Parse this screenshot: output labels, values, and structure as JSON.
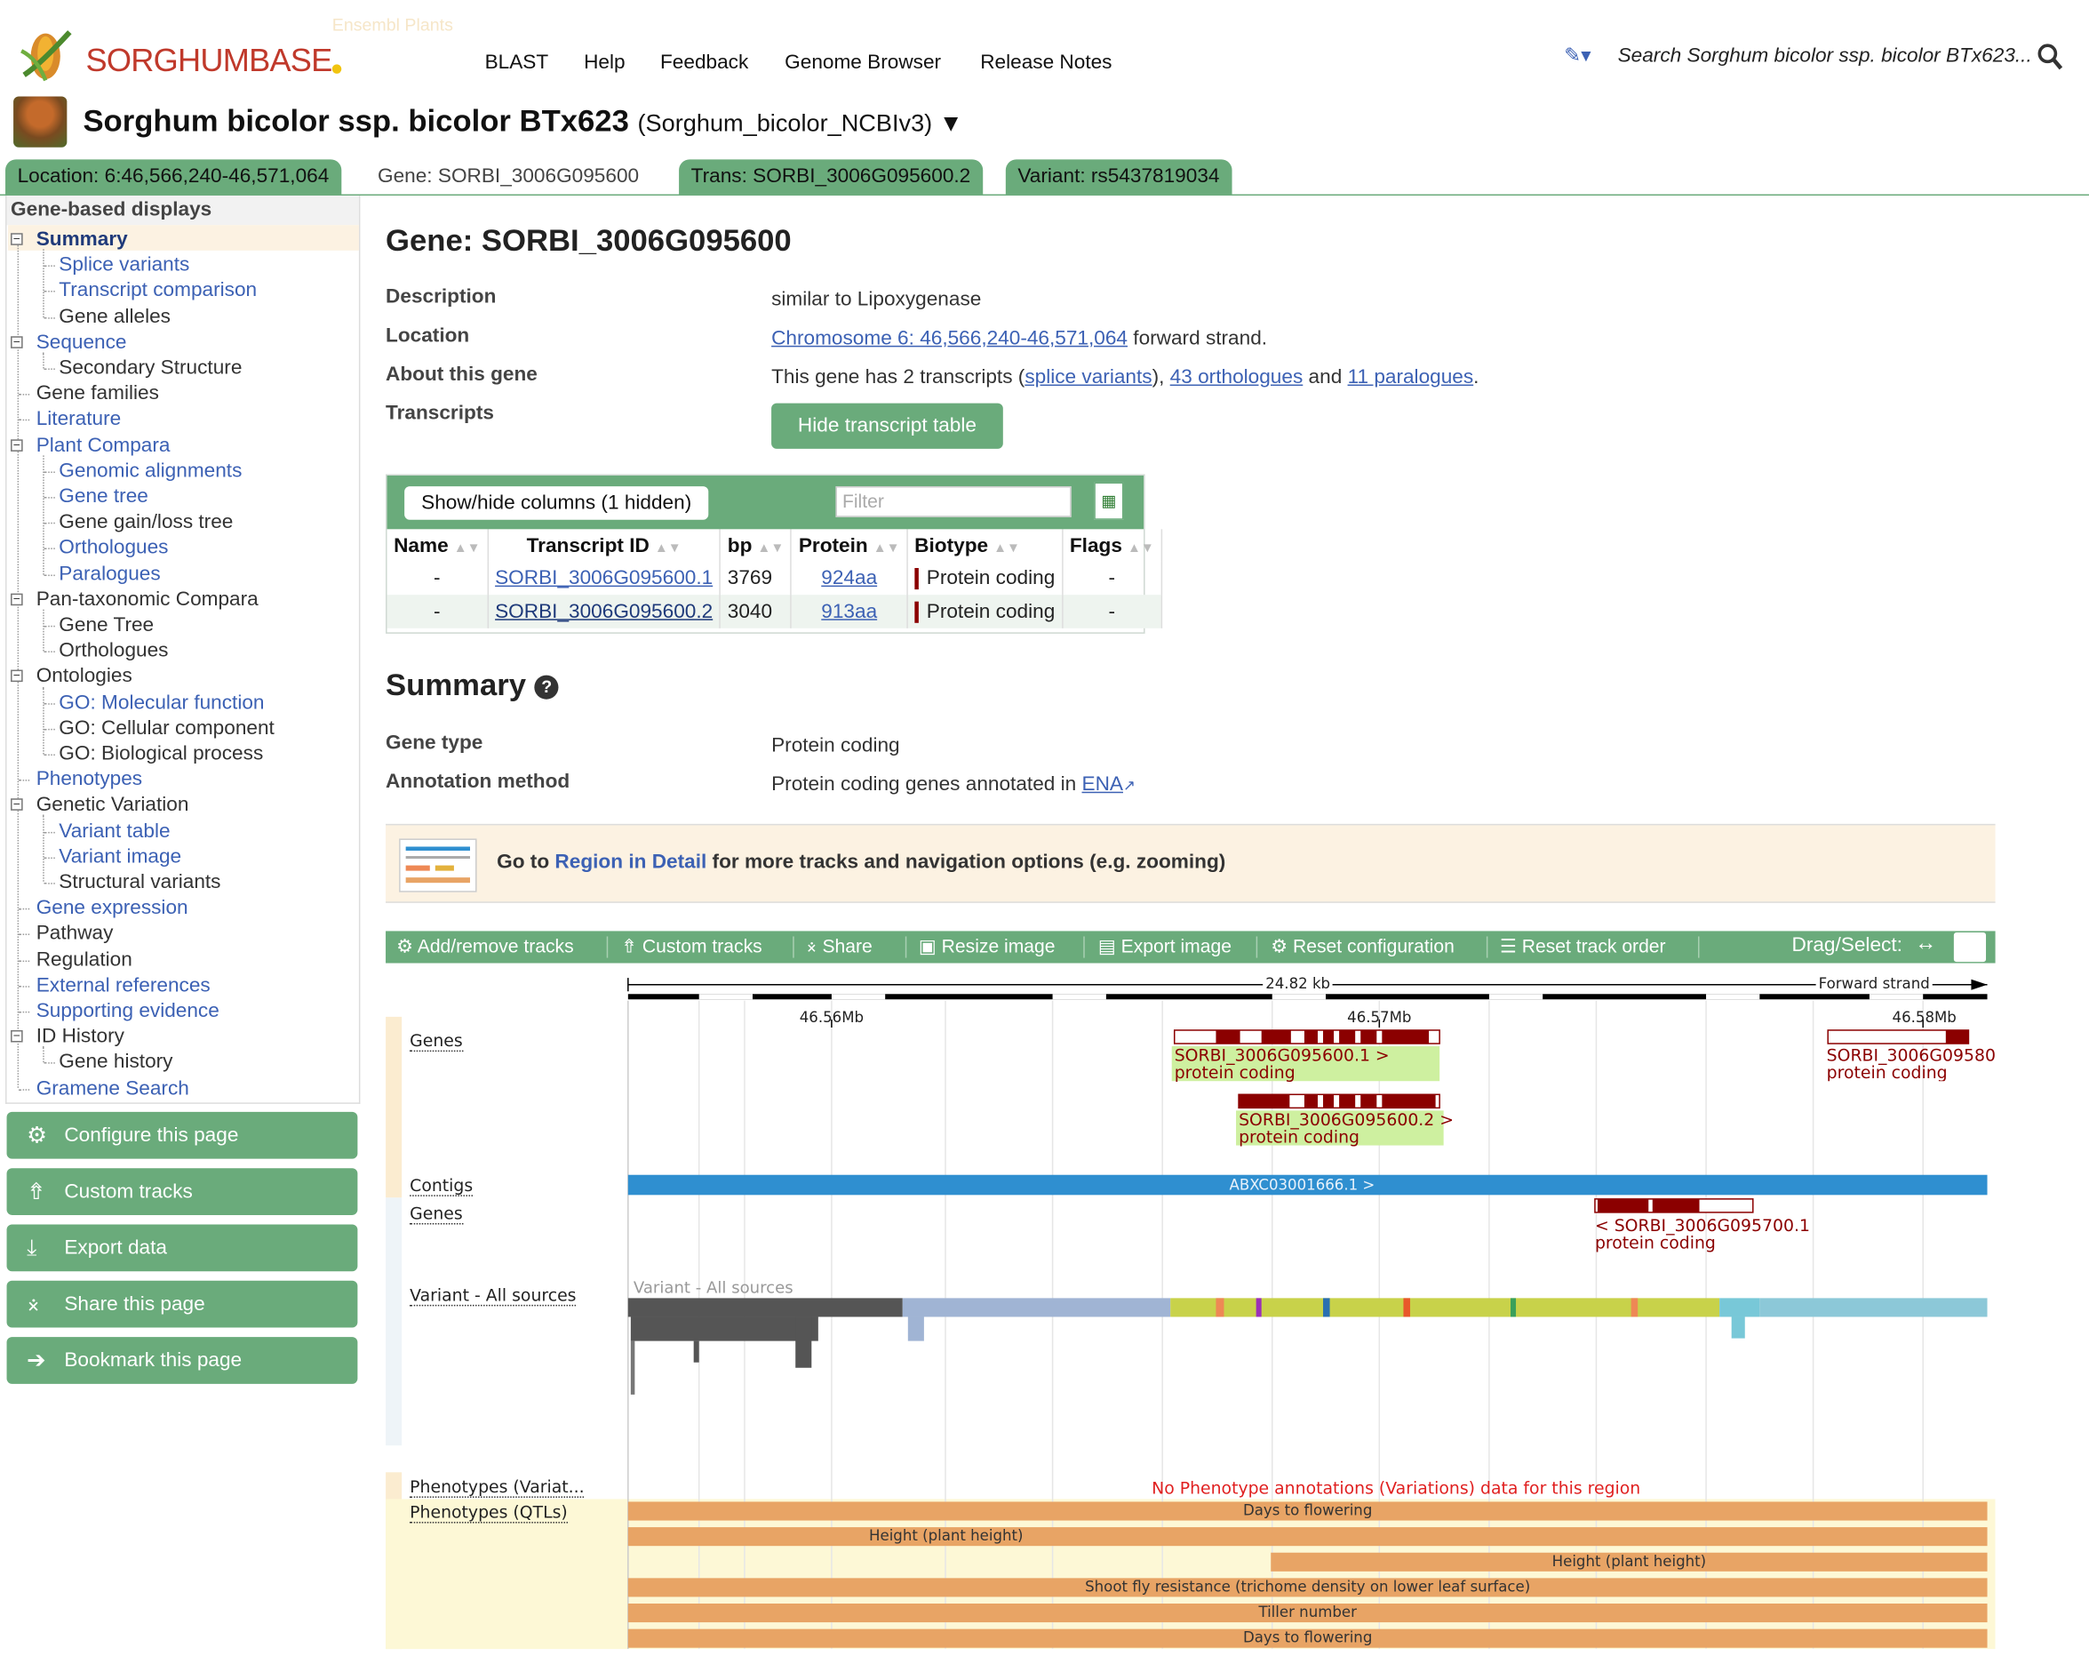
{
  "header": {
    "logo_text": "SORGHUMBASE",
    "ensembl_text": "Ensembl Plants",
    "nav": [
      "BLAST",
      "Help",
      "Feedback",
      "Genome Browser",
      "Release Notes"
    ],
    "search_placeholder": "Search Sorghum bicolor ssp. bicolor BTx623..."
  },
  "species": {
    "name": "Sorghum bicolor ssp. bicolor BTx623",
    "assembly": "(Sorghum_bicolor_NCBIv3) ▼"
  },
  "tabs": [
    {
      "label": "Location: 6:46,566,240-46,571,064"
    },
    {
      "label": "Gene: SORBI_3006G095600"
    },
    {
      "label": "Trans: SORBI_3006G095600.2"
    },
    {
      "label": "Variant: rs5437819034"
    }
  ],
  "sidebar": {
    "title": "Gene-based displays",
    "items": [
      {
        "label": "Summary"
      },
      {
        "label": "Splice variants"
      },
      {
        "label": "Transcript comparison"
      },
      {
        "label": "Gene alleles"
      },
      {
        "label": "Sequence"
      },
      {
        "label": "Secondary Structure"
      },
      {
        "label": "Gene families"
      },
      {
        "label": "Literature"
      },
      {
        "label": "Plant Compara"
      },
      {
        "label": "Genomic alignments"
      },
      {
        "label": "Gene tree"
      },
      {
        "label": "Gene gain/loss tree"
      },
      {
        "label": "Orthologues"
      },
      {
        "label": "Paralogues"
      },
      {
        "label": "Pan-taxonomic Compara"
      },
      {
        "label": "Gene Tree"
      },
      {
        "label": "Orthologues"
      },
      {
        "label": "Ontologies"
      },
      {
        "label": "GO: Molecular function"
      },
      {
        "label": "GO: Cellular component"
      },
      {
        "label": "GO: Biological process"
      },
      {
        "label": "Phenotypes"
      },
      {
        "label": "Genetic Variation"
      },
      {
        "label": "Variant table"
      },
      {
        "label": "Variant image"
      },
      {
        "label": "Structural variants"
      },
      {
        "label": "Gene expression"
      },
      {
        "label": "Pathway"
      },
      {
        "label": "Regulation"
      },
      {
        "label": "External references"
      },
      {
        "label": "Supporting evidence"
      },
      {
        "label": "ID History"
      },
      {
        "label": "Gene history"
      },
      {
        "label": "Gramene Search"
      }
    ],
    "buttons": [
      "Configure this page",
      "Custom tracks",
      "Export data",
      "Share this page",
      "Bookmark this page"
    ]
  },
  "gene": {
    "title": "Gene: SORBI_3006G095600",
    "description_label": "Description",
    "description": "similar to Lipoxygenase",
    "location_label": "Location",
    "location_link": "Chromosome 6: 46,566,240-46,571,064",
    "location_suffix": " forward strand.",
    "about_label": "About this gene",
    "about_pre": "This gene has 2 transcripts (",
    "about_splice": "splice variants",
    "about_mid1": "), ",
    "about_orth": "43 orthologues",
    "about_mid2": " and ",
    "about_para": "11 paralogues",
    "about_end": ".",
    "transcripts_label": "Transcripts",
    "hide_button": "Hide transcript table"
  },
  "transcript_table": {
    "show_hide": "Show/hide columns (1 hidden)",
    "filter_placeholder": "Filter",
    "columns": [
      "Name",
      "Transcript ID",
      "bp",
      "Protein",
      "Biotype",
      "Flags"
    ],
    "rows": [
      [
        "-",
        "SORBI_3006G095600.1",
        "3769",
        "924aa",
        "Protein coding",
        "-"
      ],
      [
        "-",
        "SORBI_3006G095600.2",
        "3040",
        "913aa",
        "Protein coding",
        "-"
      ]
    ]
  },
  "summary": {
    "title": "Summary",
    "gene_type_label": "Gene type",
    "gene_type": "Protein coding",
    "annotation_label": "Annotation method",
    "annotation_pre": "Protein coding genes annotated in ",
    "annotation_link": "ENA"
  },
  "banner": {
    "pre": "Go to ",
    "link": "Region in Detail",
    "post": " for more tracks and navigation options (e.g. zooming)"
  },
  "image_toolbar": {
    "items": [
      "Add/remove tracks",
      "Custom tracks",
      "Share",
      "Resize image",
      "Export image",
      "Reset configuration",
      "Reset track order"
    ],
    "drag_select": "Drag/Select:"
  },
  "genome_image": {
    "scale_label": "24.82 kb",
    "strand_label": "Forward strand",
    "ticks": [
      "46.56Mb",
      "46.57Mb",
      "46.58Mb"
    ],
    "track_names": [
      "Genes",
      "Contigs",
      "Genes",
      "Variant - All sources",
      "Phenotypes (Variat...",
      "Phenotypes (QTLs)"
    ],
    "gene1_label": "SORBI_3006G095600.1 >",
    "gene1_type": "protein coding",
    "gene2_label": "SORBI_3006G095600.2 >",
    "gene2_type": "protein coding",
    "gene3_label": "SORBI_3006G09580",
    "gene3_type": "protein coding",
    "contig_label": "ABXC03001666.1 >",
    "rev_gene_label": "< SORBI_3006G095700.1",
    "rev_gene_type": "protein coding",
    "variant_track_title": "Variant - All sources",
    "no_pheno": "No Phenotype annotations (Variations) data for this region",
    "qtls": [
      "Days to flowering",
      "Height (plant height)",
      "Height (plant height)",
      "Shoot fly resistance (trichome density on lower leaf surface)",
      "Tiller number",
      "Days to flowering"
    ]
  },
  "colors": {
    "accent_green": "#6aab7b",
    "gene_red": "#8b0000",
    "contig_blue": "#2f8fd0",
    "qtl_orange": "#e8a465",
    "link_blue": "#3c61b4"
  }
}
